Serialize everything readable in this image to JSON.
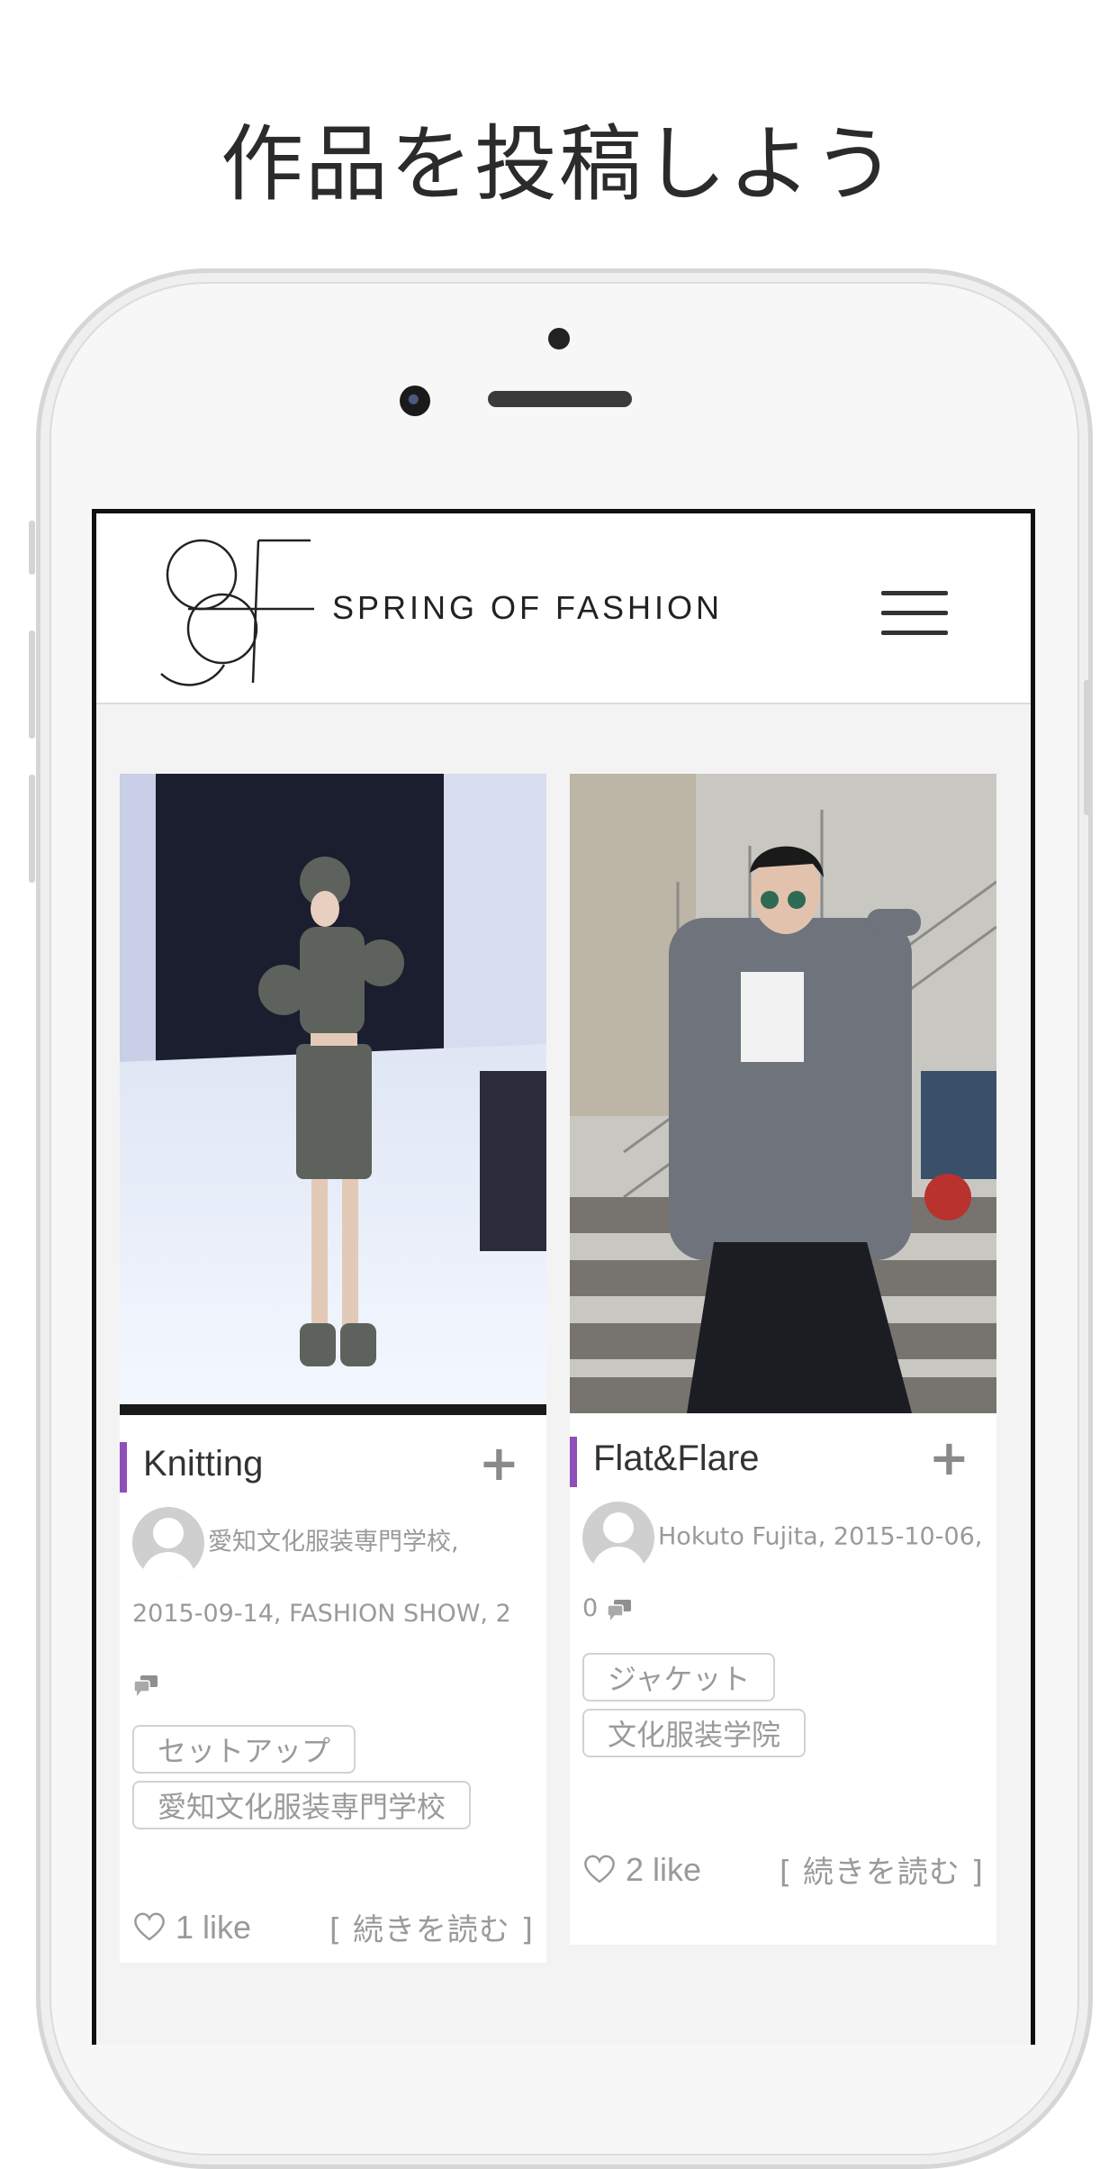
{
  "headline": "作品を投稿しよう",
  "app": {
    "brand": "SPRING OF FASHION",
    "menu_icon": "hamburger-menu-icon"
  },
  "cards": [
    {
      "title": "Knitting",
      "meta_line1": "愛知文化服装専門学校,",
      "meta_line2": "2015-09-14, FASHION SHOW, 2",
      "tags": [
        "セットアップ",
        "愛知文化服装専門学校"
      ],
      "likes": "1 like",
      "read_more": "[ 続きを読む ]"
    },
    {
      "title": "Flat&Flare",
      "meta_line1": "Hokuto Fujita, 2015-10-06,",
      "meta_line2": "0",
      "tags": [
        "ジャケット",
        "文化服装学院"
      ],
      "likes": "2 like",
      "read_more": "[ 続きを読む ]"
    }
  ],
  "colors": {
    "accent": "#8e4fb8",
    "text_muted": "#9a9a9a"
  }
}
